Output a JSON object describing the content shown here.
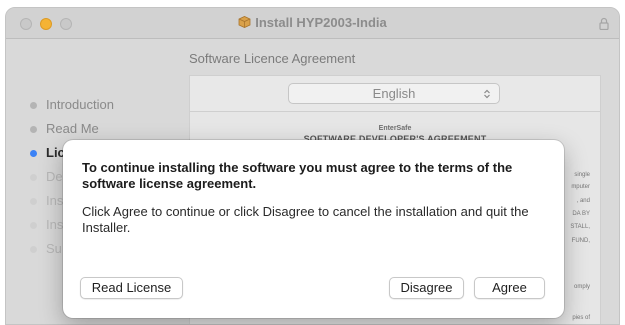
{
  "window": {
    "title": "Install HYP2003-India"
  },
  "page_subtitle": "Software Licence Agreement",
  "sidebar": {
    "steps": [
      {
        "label": "Introduction",
        "state": "done"
      },
      {
        "label": "Read Me",
        "state": "done"
      },
      {
        "label": "Lic",
        "state": "active"
      },
      {
        "label": "De",
        "state": "faded"
      },
      {
        "label": "Ins",
        "state": "faded"
      },
      {
        "label": "Ins",
        "state": "faded"
      },
      {
        "label": "Su",
        "state": "faded"
      }
    ]
  },
  "language_select": {
    "value": "English"
  },
  "document": {
    "company": "EnterSafe",
    "heading": "SOFTWARE DEVELOPER'S AGREEMENT",
    "fragments": [
      "single",
      "mputer",
      ", and",
      "DA BY",
      "STALL,",
      "FUND,",
      "omply",
      "pies of"
    ]
  },
  "dialog": {
    "title": "To continue installing the software you must agree to the terms of the software license agreement.",
    "body": "Click Agree to continue or click Disagree to cancel the installation and quit the Installer.",
    "buttons": {
      "read_license": "Read License",
      "disagree": "Disagree",
      "agree": "Agree"
    }
  },
  "colors": {
    "accent": "#3b82f6",
    "minimize": "#f4b335"
  }
}
